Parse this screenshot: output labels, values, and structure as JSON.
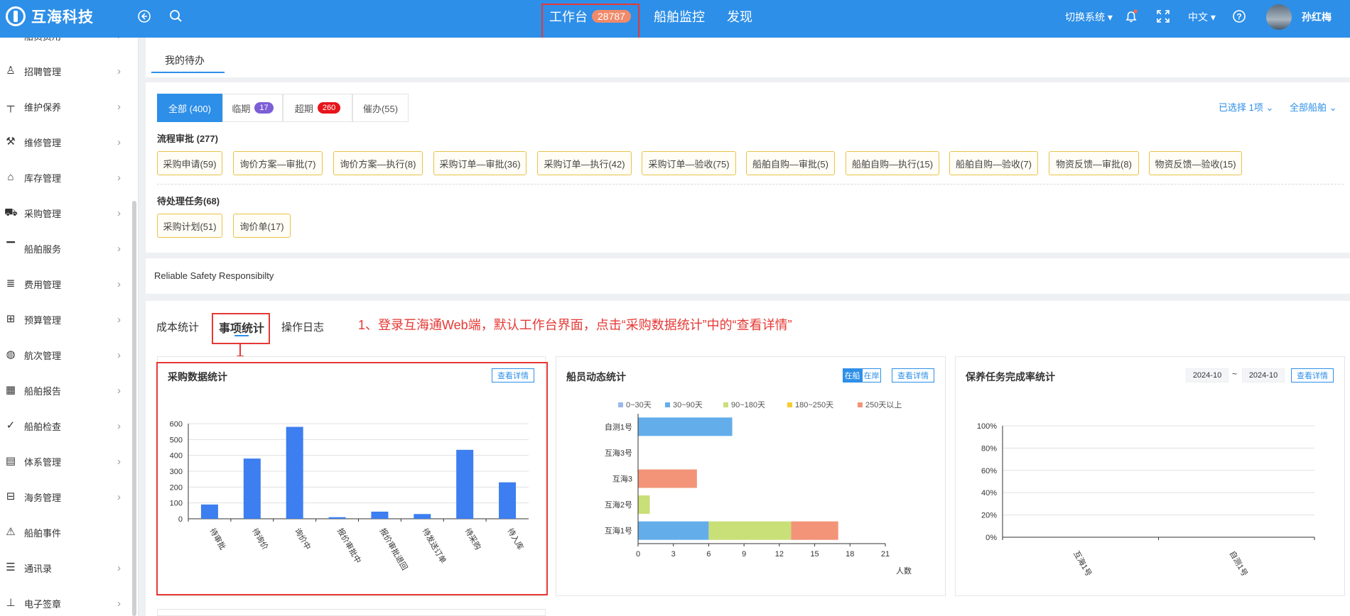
{
  "header": {
    "logo_text": "互海科技",
    "nav": [
      {
        "label": "工作台",
        "count": "28787"
      },
      {
        "label": "船舶监控"
      },
      {
        "label": "发现"
      }
    ],
    "switch_system": "切换系统",
    "language": "中文",
    "user_name": "孙红梅"
  },
  "sidebar": {
    "items": [
      {
        "label": "船员费用",
        "icon": "wallet-icon"
      },
      {
        "label": "招聘管理",
        "icon": "user-icon"
      },
      {
        "label": "维护保养",
        "icon": "hammer-icon"
      },
      {
        "label": "维修管理",
        "icon": "wrench-icon"
      },
      {
        "label": "库存管理",
        "icon": "warehouse-icon"
      },
      {
        "label": "采购管理",
        "icon": "cart-icon"
      },
      {
        "label": "船舶服务",
        "icon": "paint-roller-icon"
      },
      {
        "label": "费用管理",
        "icon": "coins-icon"
      },
      {
        "label": "预算管理",
        "icon": "budget-icon"
      },
      {
        "label": "航次管理",
        "icon": "globe-icon"
      },
      {
        "label": "船舶报告",
        "icon": "calendar-icon"
      },
      {
        "label": "船舶检查",
        "icon": "check-circle-icon"
      },
      {
        "label": "体系管理",
        "icon": "document-icon"
      },
      {
        "label": "海务管理",
        "icon": "signpost-icon"
      },
      {
        "label": "船舶事件",
        "icon": "warning-icon"
      },
      {
        "label": "通讯录",
        "icon": "contacts-icon"
      },
      {
        "label": "电子签章",
        "icon": "stamp-icon"
      }
    ]
  },
  "todo": {
    "tab": "我的待办",
    "filters": [
      {
        "label": "全部 (400)"
      },
      {
        "label": "临期",
        "count": "17",
        "color": "#7c5fd6"
      },
      {
        "label": "超期",
        "count": "260",
        "color": "#e8141b"
      },
      {
        "label": "催办(55)"
      }
    ],
    "selected": "已选择 1项",
    "all_ships": "全部船舶",
    "process_title": "流程审批 (277)",
    "process_tags": [
      "采购申请(59)",
      "询价方案—审批(7)",
      "询价方案—执行(8)",
      "采购订单—审批(36)",
      "采购订单—执行(42)",
      "采购订单—验收(75)",
      "船舶自购—审批(5)",
      "船舶自购—执行(15)",
      "船舶自购—验收(7)",
      "物资反馈—审批(8)",
      "物资反馈—验收(15)"
    ],
    "pending_title": "待处理任务(68)",
    "pending_tags": [
      "采购计划(51)",
      "询价单(17)"
    ]
  },
  "banner_text": "Reliable Safety Responsibilty",
  "stats_tabs": [
    "成本统计",
    "事项统计",
    "操作日志"
  ],
  "annotation": "1、登录互海通Web端，默认工作台界面，点击“采购数据统计”中的“查看详情”",
  "purchase_card": {
    "title": "采购数据统计",
    "detail": "查看详情"
  },
  "crew_card": {
    "title": "船员动态统计",
    "toggle": [
      "在船",
      "在岸"
    ],
    "detail": "查看详情"
  },
  "maint_card": {
    "title": "保养任务完成率统计",
    "date_from": "2024-10",
    "tilde": "~",
    "date_to": "2024-10",
    "detail": "查看详情"
  },
  "chart_data": [
    {
      "type": "bar",
      "categories": [
        "待审批",
        "待询价",
        "询价中",
        "报价审批中",
        "报价审批退回",
        "待发送订单",
        "待采购",
        "待入库"
      ],
      "values": [
        90,
        380,
        580,
        10,
        45,
        30,
        435,
        230
      ],
      "ylim": [
        0,
        600
      ],
      "yticks": [
        0,
        100,
        200,
        300,
        400,
        500,
        600
      ],
      "color": "#3d7ef0"
    },
    {
      "type": "bar",
      "orientation": "horizontal-stacked",
      "categories": [
        "互海1号",
        "互海2号",
        "互海3",
        "互海3号",
        "自测1号"
      ],
      "series": [
        {
          "name": "0~30天",
          "color": "#9db7ec",
          "values": [
            0,
            0,
            0,
            0,
            0
          ]
        },
        {
          "name": "30~90天",
          "color": "#63aeea",
          "values": [
            6,
            0,
            0,
            0,
            8
          ]
        },
        {
          "name": "90~180天",
          "color": "#c9df78",
          "values": [
            7,
            1,
            0,
            0,
            0
          ]
        },
        {
          "name": "180~250天",
          "color": "#f5cc2f",
          "values": [
            0,
            0,
            0,
            0,
            0
          ]
        },
        {
          "name": "250天以上",
          "color": "#f39479",
          "values": [
            4,
            0,
            5,
            0,
            0
          ]
        }
      ],
      "xlim": [
        0,
        21
      ],
      "xticks": [
        0,
        3,
        6,
        9,
        12,
        15,
        18,
        21
      ],
      "xlabel": "人数"
    },
    {
      "type": "bar",
      "categories": [
        "互海1号",
        "自测1号"
      ],
      "values": [
        0,
        0
      ],
      "yticks": [
        "0%",
        "20%",
        "40%",
        "60%",
        "80%",
        "100%"
      ],
      "ylim": [
        0,
        100
      ]
    }
  ]
}
